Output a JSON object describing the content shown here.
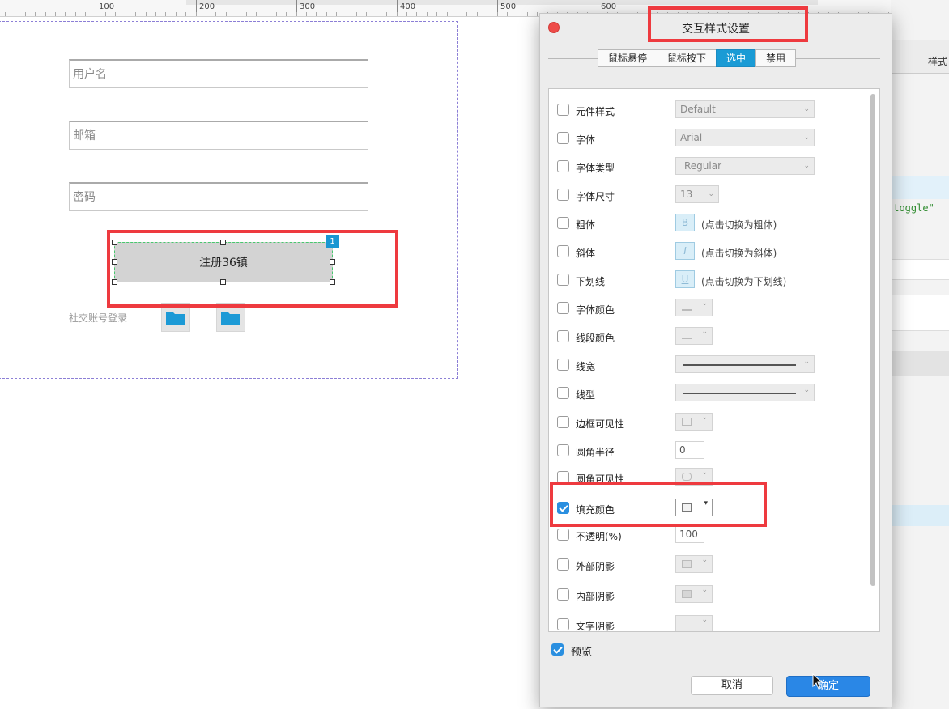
{
  "ruler": {
    "labels": [
      "100",
      "200",
      "300",
      "400",
      "500",
      "600"
    ]
  },
  "form": {
    "username_placeholder": "用户名",
    "email_placeholder": "邮箱",
    "password_placeholder": "密码",
    "register_label": "注册36镇",
    "badge": "1",
    "social_label": "社交账号登录"
  },
  "right_panel": {
    "style_label": "样式",
    "toggle_text": "\"toggle\""
  },
  "dialog": {
    "title": "交互样式设置",
    "tabs": [
      "鼠标悬停",
      "鼠标按下",
      "选中",
      "禁用"
    ],
    "active_tab": "选中",
    "rows": {
      "element_style": {
        "label": "元件样式",
        "value": "Default"
      },
      "font": {
        "label": "字体",
        "value": "Arial"
      },
      "font_type": {
        "label": "字体类型",
        "value": "Regular"
      },
      "font_size": {
        "label": "字体尺寸",
        "value": "13"
      },
      "bold": {
        "label": "粗体",
        "button": "B",
        "hint": "(点击切换为粗体)"
      },
      "italic": {
        "label": "斜体",
        "button": "I",
        "hint": "(点击切换为斜体)"
      },
      "underline": {
        "label": "下划线",
        "button": "U",
        "hint": "(点击切换为下划线)"
      },
      "font_color": {
        "label": "字体颜色"
      },
      "line_color": {
        "label": "线段颜色"
      },
      "line_width": {
        "label": "线宽"
      },
      "line_type": {
        "label": "线型"
      },
      "border_visible": {
        "label": "边框可见性"
      },
      "corner_radius": {
        "label": "圆角半径",
        "value": "0"
      },
      "corner_visible": {
        "label": "圆角可见性"
      },
      "fill_color": {
        "label": "填充颜色",
        "checked": true
      },
      "opacity": {
        "label": "不透明(%)",
        "value": "100"
      },
      "outer_shadow": {
        "label": "外部阴影"
      },
      "inner_shadow": {
        "label": "内部阴影"
      },
      "text_shadow": {
        "label": "文字阴影"
      }
    },
    "preview_label": "预览",
    "preview_checked": true,
    "cancel_label": "取消",
    "ok_label": "确定"
  },
  "colors": {
    "accent": "#1a9bd5",
    "highlight": "#ee3a3f",
    "ok_button": "#2a87e6"
  }
}
